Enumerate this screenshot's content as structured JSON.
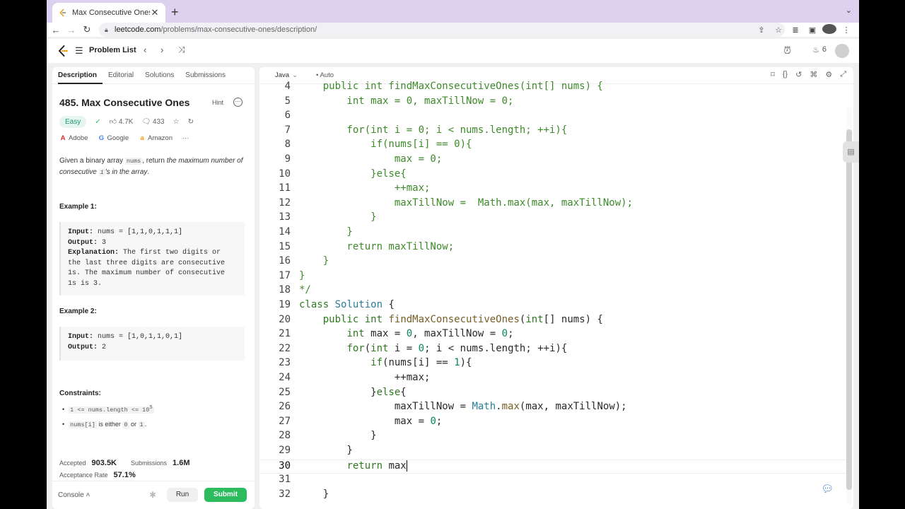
{
  "browser": {
    "tab_title": "Max Consecutive Ones - LeetC",
    "url_host": "leetcode.com",
    "url_path": "/problems/max-consecutive-ones/description/"
  },
  "header": {
    "problem_list": "Problem List",
    "streak_count": "6"
  },
  "left": {
    "tabs": [
      "Description",
      "Editorial",
      "Solutions",
      "Submissions"
    ],
    "title": "485. Max Consecutive Ones",
    "hint": "Hint",
    "difficulty": "Easy",
    "likes": "4.7K",
    "comments": "433",
    "companies": [
      "Adobe",
      "Google",
      "Amazon",
      "···"
    ],
    "desc_part1": "Given a binary array ",
    "desc_code1": "nums",
    "desc_part2": ", return ",
    "desc_part3": "the maximum number of consecutive ",
    "desc_code2": "1",
    "desc_part4": "'s in the array",
    "desc_part5": ".",
    "ex1_title": "Example 1:",
    "ex1_input_label": "Input:",
    "ex1_input": "nums = [1,1,0,1,1,1]",
    "ex1_output_label": "Output:",
    "ex1_output": "3",
    "ex1_expl_label": "Explanation:",
    "ex1_expl": "The first two digits or the last three digits are consecutive 1s. The maximum number of consecutive 1s is 3.",
    "ex2_title": "Example 2:",
    "ex2_input_label": "Input:",
    "ex2_input": "nums = [1,0,1,1,0,1]",
    "ex2_output_label": "Output:",
    "ex2_output": "2",
    "constraints_title": "Constraints:",
    "c1_code": "1 <= nums.length <= 10",
    "c1_sup": "5",
    "c2_code1": "nums[i]",
    "c2_text1": " is either ",
    "c2_code2": "0",
    "c2_text2": " or ",
    "c2_code3": "1",
    "c2_text3": ".",
    "accepted_label": "Accepted",
    "accepted_value": "903.5K",
    "submissions_label": "Submissions",
    "submissions_value": "1.6M",
    "acceptance_label": "Acceptance Rate",
    "acceptance_value": "57.1%",
    "console": "Console",
    "run": "Run",
    "submit": "Submit"
  },
  "editor": {
    "language": "Java",
    "autocomplete": "Auto",
    "lines": [
      {
        "n": "4",
        "t": "    public int findMaxConsecutiveOnes(int[] nums) {"
      },
      {
        "n": "5",
        "t": "        int max = 0, maxTillNow = 0;"
      },
      {
        "n": "6",
        "t": ""
      },
      {
        "n": "7",
        "t": "        for(int i = 0; i < nums.length; ++i){"
      },
      {
        "n": "8",
        "t": "            if(nums[i] == 0){"
      },
      {
        "n": "9",
        "t": "                max = 0;"
      },
      {
        "n": "10",
        "t": "            }else{"
      },
      {
        "n": "11",
        "t": "                ++max;"
      },
      {
        "n": "12",
        "t": "                maxTillNow =  Math.max(max, maxTillNow);"
      },
      {
        "n": "13",
        "t": "            }"
      },
      {
        "n": "14",
        "t": "        }"
      },
      {
        "n": "15",
        "t": "        return maxTillNow;"
      },
      {
        "n": "16",
        "t": "    }"
      },
      {
        "n": "17",
        "t": "}"
      },
      {
        "n": "18",
        "t": "*/"
      },
      {
        "n": "19",
        "t": "class Solution {"
      },
      {
        "n": "20",
        "t": "    public int findMaxConsecutiveOnes(int[] nums) {"
      },
      {
        "n": "21",
        "t": "        int max = 0, maxTillNow = 0;"
      },
      {
        "n": "22",
        "t": "        for(int i = 0; i < nums.length; ++i){"
      },
      {
        "n": "23",
        "t": "            if(nums[i] == 1){"
      },
      {
        "n": "24",
        "t": "                ++max;"
      },
      {
        "n": "25",
        "t": "            }else{"
      },
      {
        "n": "26",
        "t": "                maxTillNow = Math.max(max, maxTillNow);"
      },
      {
        "n": "27",
        "t": "                max = 0;"
      },
      {
        "n": "28",
        "t": "            }"
      },
      {
        "n": "29",
        "t": "        }"
      },
      {
        "n": "30",
        "t": "        return max"
      },
      {
        "n": "31",
        "t": ""
      },
      {
        "n": "32",
        "t": "    }"
      }
    ],
    "current_line": "30"
  },
  "colors": {
    "accent_green": "#2cbb5d",
    "easy_green": "#1a9c6b",
    "comment_green": "#3d8a2a"
  }
}
